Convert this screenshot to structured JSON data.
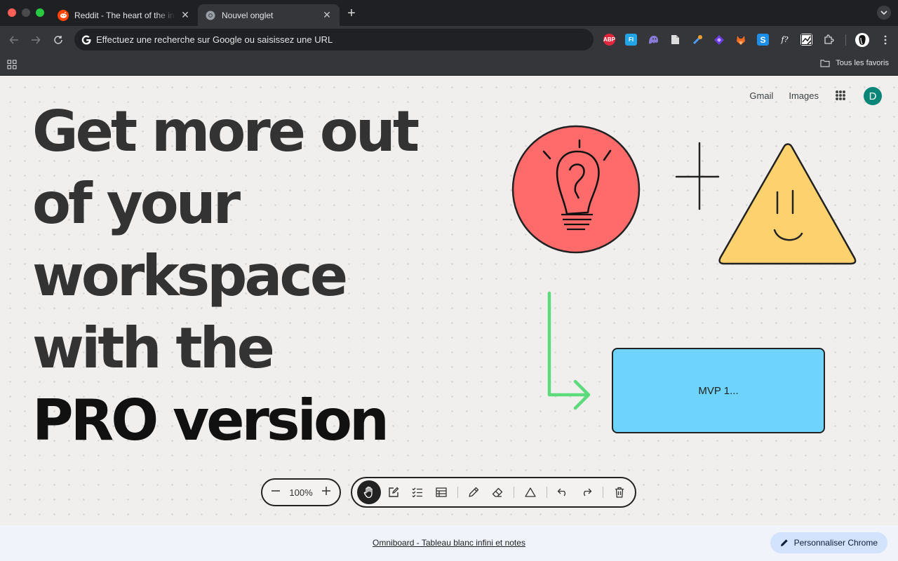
{
  "browser": {
    "tabs": [
      {
        "title": "Reddit - The heart of the internet",
        "favicon": "reddit-icon",
        "active": false
      },
      {
        "title": "Nouvel onglet",
        "favicon": "chrome-icon",
        "active": true
      }
    ],
    "omnibox": {
      "placeholder": "Effectuez une recherche sur Google ou saisissez une URL"
    },
    "extensions": [
      {
        "name": "adblock-plus-icon",
        "label": "ABP",
        "color": "#e0263d"
      },
      {
        "name": "fl-extension-icon",
        "label": "FI",
        "color": "#22a4e6"
      },
      {
        "name": "ghost-extension-icon",
        "label": "",
        "color": "#8a7bd8"
      },
      {
        "name": "document-extension-icon",
        "label": "",
        "color": "#d8d8d8"
      },
      {
        "name": "dropper-extension-icon",
        "label": "",
        "color": "#4f9cf0"
      },
      {
        "name": "diamond-extension-icon",
        "label": "",
        "color": "#6a3ce0"
      },
      {
        "name": "fox-extension-icon",
        "label": "",
        "color": "#f06a22"
      },
      {
        "name": "s-extension-icon",
        "label": "S",
        "color": "#1d8fe8"
      },
      {
        "name": "fx-extension-icon",
        "label": "f?",
        "color": "#35363a"
      },
      {
        "name": "chart-extension-icon",
        "label": "",
        "color": "#ffffff"
      },
      {
        "name": "puzzle-extensions-icon",
        "label": "",
        "color": "#35363a"
      }
    ],
    "bookmarks": {
      "all_label": "Tous les favoris"
    }
  },
  "google": {
    "links": [
      "Gmail",
      "Images"
    ],
    "avatar_letter": "D"
  },
  "hero": {
    "lines": [
      "Get more out",
      "of your",
      "workspace",
      "with the"
    ],
    "highlight": "PRO version"
  },
  "canvas": {
    "mvp_label": "MVP 1...",
    "colors": {
      "bulb": "#ff6b6b",
      "triangle": "#fdd26e",
      "box": "#6fd4fd",
      "arrow": "#5ddb7a"
    }
  },
  "whiteboard_toolbar": {
    "zoom": "100%"
  },
  "footer": {
    "link": "Omniboard - Tableau blanc infini et notes",
    "customize": "Personnaliser Chrome"
  }
}
